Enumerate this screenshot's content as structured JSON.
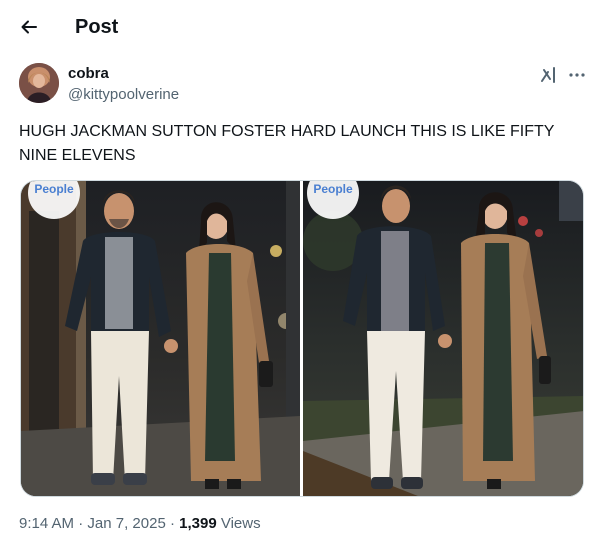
{
  "header": {
    "title": "Post",
    "back_icon": "arrow-left-icon"
  },
  "post": {
    "author": {
      "name": "cobra",
      "handle": "@kittypoolverine"
    },
    "text": "HUGH JACKMAN SUTTON FOSTER HARD LAUNCH THIS IS LIKE FIFTY NINE ELEVENS",
    "photos": [
      {
        "watermark": "People"
      },
      {
        "watermark": "People"
      }
    ],
    "time": "9:14 AM",
    "separator": "·",
    "date": "Jan 7, 2025",
    "views_count": "1,399",
    "views_label": "Views"
  },
  "icons": {
    "grok": "grok-icon",
    "more": "more-options-icon"
  },
  "colors": {
    "text": "#0f1419",
    "secondary": "#536471",
    "border": "#cfd9de"
  }
}
